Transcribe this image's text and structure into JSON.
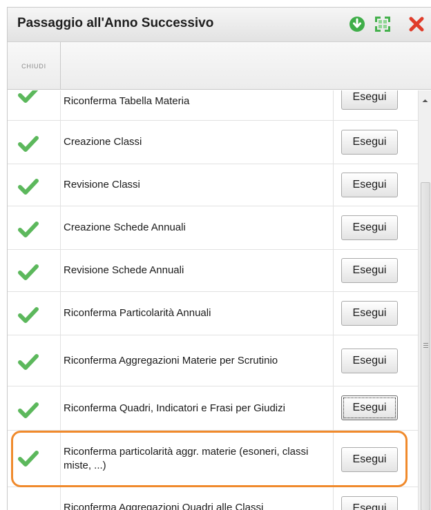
{
  "window": {
    "title": "Passaggio all'Anno Successivo",
    "icons": [
      "download-circle-icon",
      "expand-icon",
      "close-icon"
    ]
  },
  "toolbar": {
    "chiudi_label": "CHIUDI"
  },
  "rows": [
    {
      "label": "Riconferma Tabella Materia",
      "button": "Esegui",
      "done": true
    },
    {
      "label": "Creazione Classi",
      "button": "Esegui",
      "done": true
    },
    {
      "label": "Revisione Classi",
      "button": "Esegui",
      "done": true
    },
    {
      "label": "Creazione Schede Annuali",
      "button": "Esegui",
      "done": true
    },
    {
      "label": "Revisione Schede Annuali",
      "button": "Esegui",
      "done": true
    },
    {
      "label": "Riconferma Particolarità Annuali",
      "button": "Esegui",
      "done": true
    },
    {
      "label": "Riconferma Aggregazioni Materie per Scrutinio",
      "button": "Esegui",
      "done": true
    },
    {
      "label": "Riconferma Quadri, Indicatori e Frasi per Giudizi",
      "button": "Esegui",
      "done": true,
      "focused": true
    },
    {
      "label": "Riconferma particolarità aggr. materie (esoneri, classi miste, ...)",
      "button": "Esegui",
      "done": true,
      "highlighted": true
    },
    {
      "label": "Riconferma Aggregazioni Quadri alle Classi",
      "button": "Esegui",
      "done": false
    }
  ],
  "colors": {
    "check": "#5cb85c",
    "highlight": "#f08a2c",
    "close": "#e03c2a",
    "accent_green": "#3fae49"
  }
}
